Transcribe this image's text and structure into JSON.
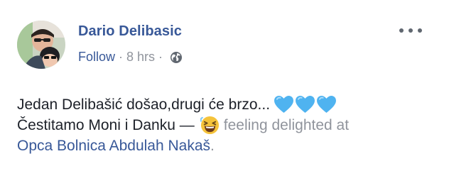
{
  "post": {
    "author": "Dario Delibasic",
    "follow": "Follow",
    "separator": "·",
    "time": "8 hrs",
    "privacy_icon": "globe-icon",
    "more_icon": "more-options-icon",
    "text_line1": "Jedan Delibašić došao,drugi će brzo...",
    "hearts": [
      "blue-heart-icon",
      "blue-heart-icon",
      "blue-heart-icon"
    ],
    "text_line2": "Čestitamo Moni i Danku —",
    "feeling_emoji": "grinning-squinting-face-icon",
    "feeling_text": "feeling delighted at",
    "place": "Opca Bolnica Abdulah Nakaš",
    "place_suffix": ".",
    "colors": {
      "link": "#385898",
      "meta": "#90949c",
      "text": "#1d2129",
      "heart": "#4fb3f0",
      "emoji": "#f5c33b"
    }
  }
}
